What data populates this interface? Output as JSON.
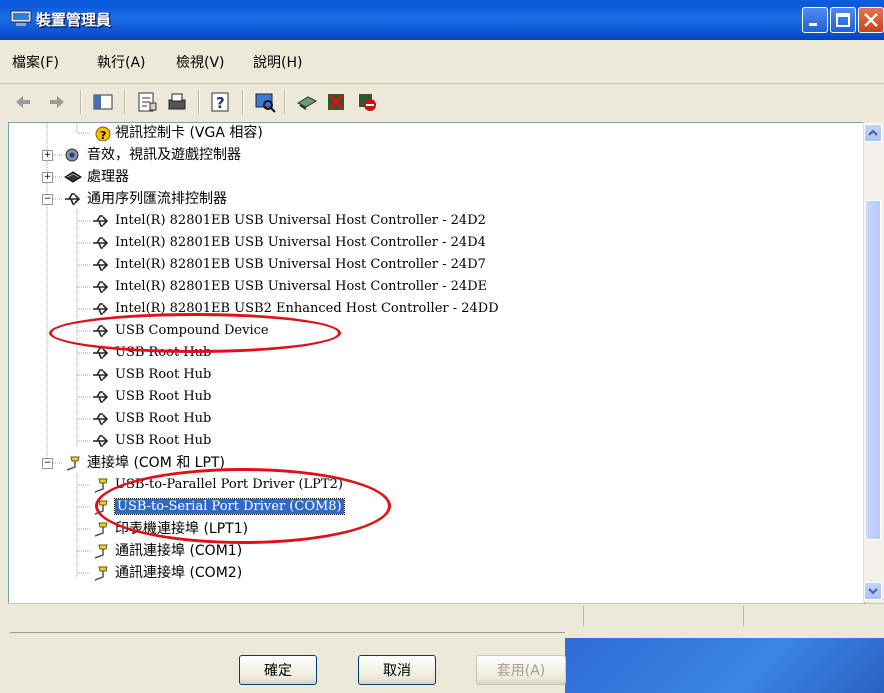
{
  "window": {
    "title": "裝置管理員"
  },
  "menu": [
    {
      "label": "檔案(F)"
    },
    {
      "label": "執行(A)"
    },
    {
      "label": "檢視(V)"
    },
    {
      "label": "說明(H)"
    }
  ],
  "tree": {
    "rows": [
      {
        "label": "視訊控制卡 (VGA 相容)"
      },
      {
        "label": "音效，視訊及遊戲控制器"
      },
      {
        "label": "處理器"
      },
      {
        "label": "通用序列匯流排控制器"
      },
      {
        "label": "Intel(R) 82801EB USB Universal Host Controller - 24D2"
      },
      {
        "label": "Intel(R) 82801EB USB Universal Host Controller - 24D4"
      },
      {
        "label": "Intel(R) 82801EB USB Universal Host Controller - 24D7"
      },
      {
        "label": "Intel(R) 82801EB USB Universal Host Controller - 24DE"
      },
      {
        "label": "Intel(R) 82801EB USB2 Enhanced Host Controller - 24DD"
      },
      {
        "label": "USB Compound Device"
      },
      {
        "label": "USB Root Hub"
      },
      {
        "label": "USB Root Hub"
      },
      {
        "label": "USB Root Hub"
      },
      {
        "label": "USB Root Hub"
      },
      {
        "label": "USB Root Hub"
      },
      {
        "label": "連接埠 (COM 和 LPT)"
      },
      {
        "label": "USB-to-Parallel Port Driver (LPT2)"
      },
      {
        "label": "USB-to-Serial Port Driver (COM8)"
      },
      {
        "label": "印表機連接埠 (LPT1)"
      },
      {
        "label": "通訊連接埠 (COM1)"
      },
      {
        "label": "通訊連接埠 (COM2)"
      }
    ]
  },
  "buttons": {
    "ok": "確定",
    "cancel": "取消",
    "apply": "套用(A)"
  },
  "colors": {
    "highlight_ellipse": "#e0101a",
    "selection": "#316ac5"
  }
}
